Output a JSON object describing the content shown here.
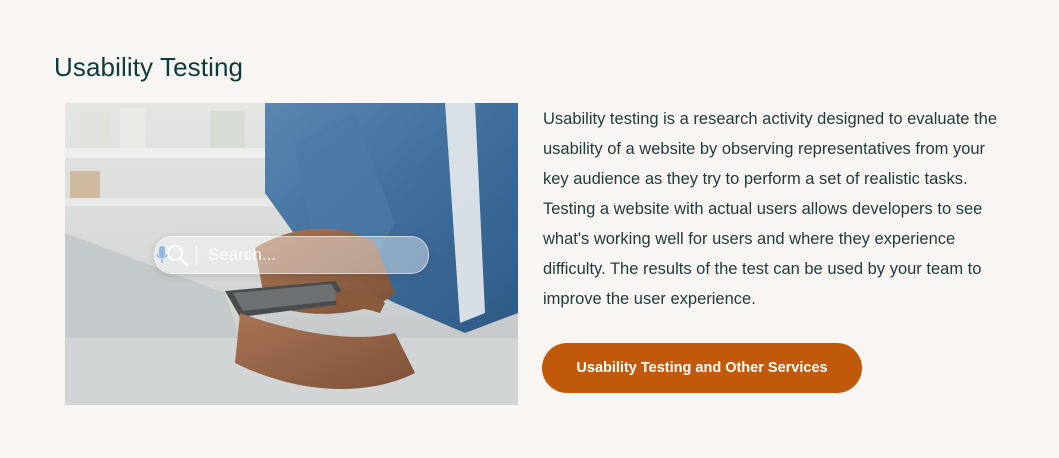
{
  "section": {
    "title": "Usability Testing",
    "description": "Usability testing is a research activity designed to evaluate the usability of a website by observing representatives from your key audience as they try to perform a set of realistic tasks. Testing a website with actual users allows developers to see what's working well for users and where they experience difficulty. The results of the test can be used by your team to improve the user experience.",
    "cta_label": "Usability Testing and Other Services"
  },
  "photo": {
    "search_placeholder": "Search...",
    "search_icon": "search-icon",
    "mic_icon": "microphone-icon"
  },
  "colors": {
    "background": "#f9f5f2",
    "heading": "#0e3b3b",
    "text": "#1f3a3d",
    "button": "#c05a0a",
    "button_text": "#ffffff"
  }
}
